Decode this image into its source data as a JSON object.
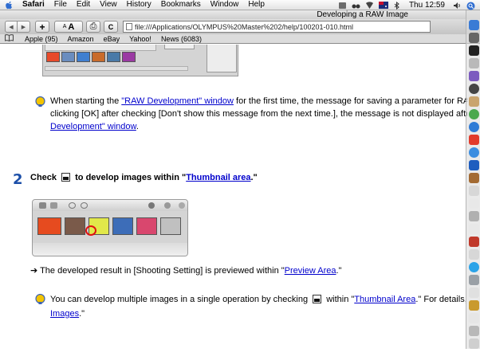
{
  "menubar": {
    "app": "Safari",
    "items": [
      "File",
      "Edit",
      "View",
      "History",
      "Bookmarks",
      "Window",
      "Help"
    ],
    "clock": "Thu 12:59"
  },
  "window": {
    "title": "Developing a RAW Image"
  },
  "toolbar": {
    "back": "◀",
    "forward": "▶",
    "add": "+",
    "text_smaller": "A",
    "text_larger": "A",
    "print": "⎙",
    "reload": "C",
    "url": "file:///Applications/OLYMPUS%20Master%202/help/100201-010.html"
  },
  "bookmarks": {
    "items": [
      "Apple (95)",
      "Amazon",
      "eBay",
      "Yahoo!",
      "News (6083)"
    ]
  },
  "content": {
    "note1": {
      "line1_pre": "When starting the ",
      "line1_link": "\"RAW Development\" window",
      "line1_post": " for the first time, the message for saving a parameter for RAW d",
      "line2": "clicking [OK] after checking [Don't show this message from the next time.], the message is not displayed after all",
      "line3_link": "Development\" window",
      "line3_post": "."
    },
    "step": {
      "number": "2",
      "pre": "Check ",
      "mid": " to develop images within \"",
      "link": "Thumbnail area",
      "post": ".\""
    },
    "result": {
      "pre": "➔ The developed result in [Shooting Setting] is previewed within \"",
      "link": "Preview Area",
      "post": ".\""
    },
    "note2": {
      "line1_pre": "You can develop multiple images in a single operation by checking ",
      "line1_mid": " within \"",
      "line1_link": "Thumbnail Area",
      "line1_post": ".\" For details, refer",
      "line2_link": "Images",
      "line2_post": ".\""
    }
  },
  "colors": {
    "link": "#0000cc",
    "step_number": "#1c4fa8"
  }
}
